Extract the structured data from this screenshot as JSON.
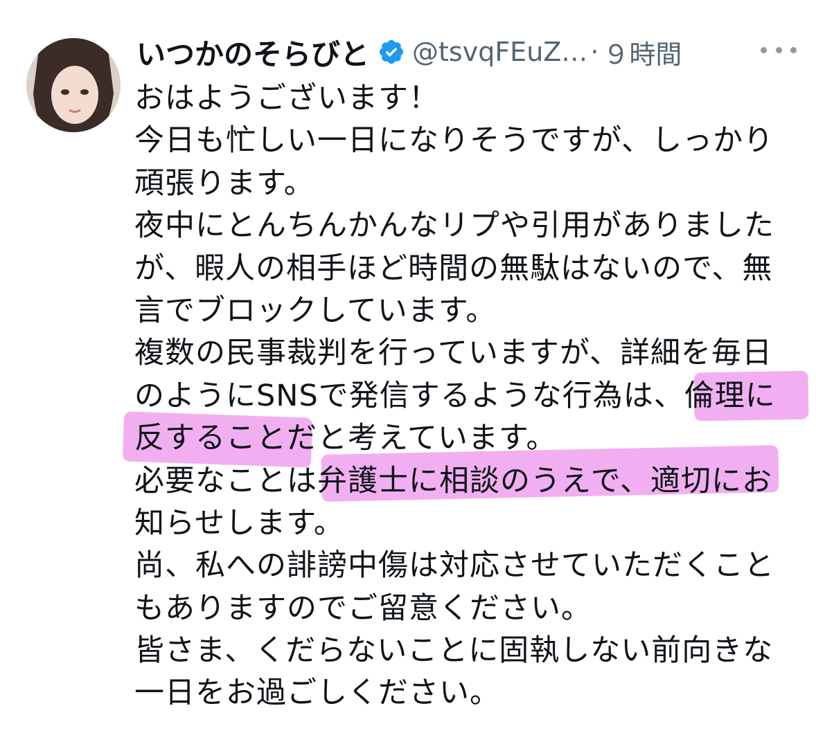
{
  "tweet": {
    "author_name": "いつかのそらびと",
    "handle": "@tsvqFEuZ…",
    "separator": "·",
    "timestamp": "９時間",
    "verified": true,
    "more_icon": "ellipsis-icon",
    "lines": [
      "おはようございます！",
      "今日も忙しい一日になりそうですが、しっかり",
      "頑張ります。",
      "夜中にとんちんかんなリプや引用がありました",
      "が、暇人の相手ほど時間の無駄はないので、無",
      "言でブロックしています。",
      "複数の民事裁判を行っていますが、詳細を毎日",
      "のようにSNSで発信するような行為は、倫理に",
      "反することだと考えています。",
      "必要なことは弁護士に相談のうえで、適切にお",
      "知らせします。",
      "尚、私への誹謗中傷は対応させていただくこと",
      "もありますのでご留意ください。",
      "皆さま、くだらないことに固執しない前向きな",
      "一日をお過ごしください。"
    ],
    "highlighted_phrases": [
      "倫理に",
      "反することだ",
      "弁護士に相談のうえで、適切にお"
    ]
  },
  "colors": {
    "name": "#0f1419",
    "secondary": "#536471",
    "verified_badge": "#1d9bf0",
    "highlighter": "#e66ee6"
  }
}
